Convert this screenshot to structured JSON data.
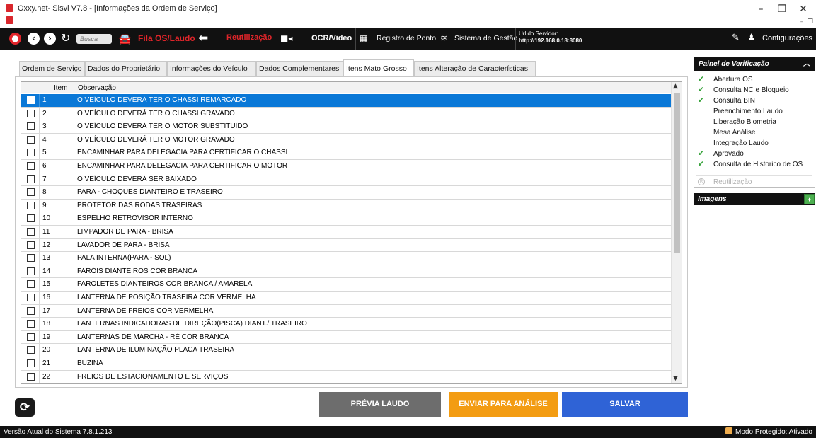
{
  "window": {
    "title": "Oxxy.net- Sisvi V7.8 - [Informações da Ordem de Serviço]",
    "minimize": "–",
    "restore": "❐",
    "close": "✕"
  },
  "toolbar": {
    "search_placeholder": "Busca",
    "fila_label": "Fila OS/Laudo",
    "reutilizacao_label": "Reutilização",
    "ocr_label": "OCR/Video",
    "registro_label": "Registro de Ponto",
    "sistema_label": "Sistema de Gestão",
    "url_label": "Url do Servidor:",
    "url_value": "http://192.168.0.18:8080",
    "config_label": "Configurações"
  },
  "tabs": [
    {
      "label": "Ordem de Serviço"
    },
    {
      "label": "Dados do Proprietário"
    },
    {
      "label": "Informações do Veículo"
    },
    {
      "label": "Dados Complementares"
    },
    {
      "label": "Itens Mato Grosso"
    },
    {
      "label": "Itens Alteração de Características"
    }
  ],
  "active_tab": "Itens Mato Grosso",
  "grid": {
    "col_item": "Item",
    "col_obs": "Observação",
    "rows": [
      {
        "item": "1",
        "obs": "O VEÍCULO DEVERÁ TER O CHASSI REMARCADO"
      },
      {
        "item": "2",
        "obs": "O VEÍCULO DEVERÁ TER O CHASSI GRAVADO"
      },
      {
        "item": "3",
        "obs": "O VEÍCULO DEVERÁ TER O MOTOR SUBSTITUÍDO"
      },
      {
        "item": "4",
        "obs": "O VEÍCULO DEVERÁ TER O MOTOR GRAVADO"
      },
      {
        "item": "5",
        "obs": "ENCAMINHAR PARA DELEGACIA PARA CERTIFICAR O CHASSI"
      },
      {
        "item": "6",
        "obs": "ENCAMINHAR PARA DELEGACIA PARA CERTIFICAR O MOTOR"
      },
      {
        "item": "7",
        "obs": "O VEÍCULO DEVERÁ SER BAIXADO"
      },
      {
        "item": "8",
        "obs": "PARA - CHOQUES DIANTEIRO E TRASEIRO"
      },
      {
        "item": "9",
        "obs": "PROTETOR DAS RODAS TRASEIRAS"
      },
      {
        "item": "10",
        "obs": "ESPELHO RETROVISOR INTERNO"
      },
      {
        "item": "11",
        "obs": "LIMPADOR DE PARA - BRISA"
      },
      {
        "item": "12",
        "obs": "LAVADOR DE PARA - BRISA"
      },
      {
        "item": "13",
        "obs": "PALA INTERNA(PARA - SOL)"
      },
      {
        "item": "14",
        "obs": "FARÓIS DIANTEIROS COR BRANCA"
      },
      {
        "item": "15",
        "obs": "FAROLETES DIANTEIROS COR BRANCA / AMARELA"
      },
      {
        "item": "16",
        "obs": "LANTERNA DE POSIÇÃO TRASEIRA COR VERMELHA"
      },
      {
        "item": "17",
        "obs": "LANTERNA DE FREIOS COR VERMELHA"
      },
      {
        "item": "18",
        "obs": "LANTERNAS INDICADORAS DE DIREÇÃO(PISCA) DIANT./ TRASEIRO"
      },
      {
        "item": "19",
        "obs": "LANTERNAS DE MARCHA - RÉ COR BRANCA"
      },
      {
        "item": "20",
        "obs": "LANTERNA DE ILUMINAÇÃO PLACA TRASEIRA"
      },
      {
        "item": "21",
        "obs": "BUZINA"
      },
      {
        "item": "22",
        "obs": "FREIOS DE ESTACIONAMENTO E SERVIÇOS"
      }
    ]
  },
  "buttons": {
    "previa": "PRÉVIA LAUDO",
    "enviar": "ENVIAR PARA ANÁLISE",
    "salvar": "SALVAR"
  },
  "verification_panel": {
    "title": "Painel de Verificação",
    "items": [
      {
        "label": "Abertura OS",
        "checked": true
      },
      {
        "label": "Consulta NC e Bloqueio",
        "checked": true
      },
      {
        "label": "Consulta BIN",
        "checked": true
      },
      {
        "label": "Preenchimento Laudo",
        "checked": false
      },
      {
        "label": "Liberação Biometria",
        "checked": false
      },
      {
        "label": "Mesa Análise",
        "checked": false
      },
      {
        "label": "Integração Laudo",
        "checked": false
      },
      {
        "label": "Aprovado",
        "checked": true
      },
      {
        "label": "Consulta de Historico de OS",
        "checked": true
      }
    ],
    "reutilizacao": "Reutilização"
  },
  "images_panel": {
    "title": "Imagens"
  },
  "statusbar": {
    "version": "Versão Atual do Sistema 7.8.1.213",
    "mode": "Modo Protegido: Ativado"
  },
  "colors": {
    "selected_row": "#0a78d7",
    "accent_red": "#e1252a",
    "btn_previa": "#6d6d6d",
    "btn_enviar": "#f39c12",
    "btn_salvar": "#2f63d6",
    "check_green": "#37a33b"
  }
}
